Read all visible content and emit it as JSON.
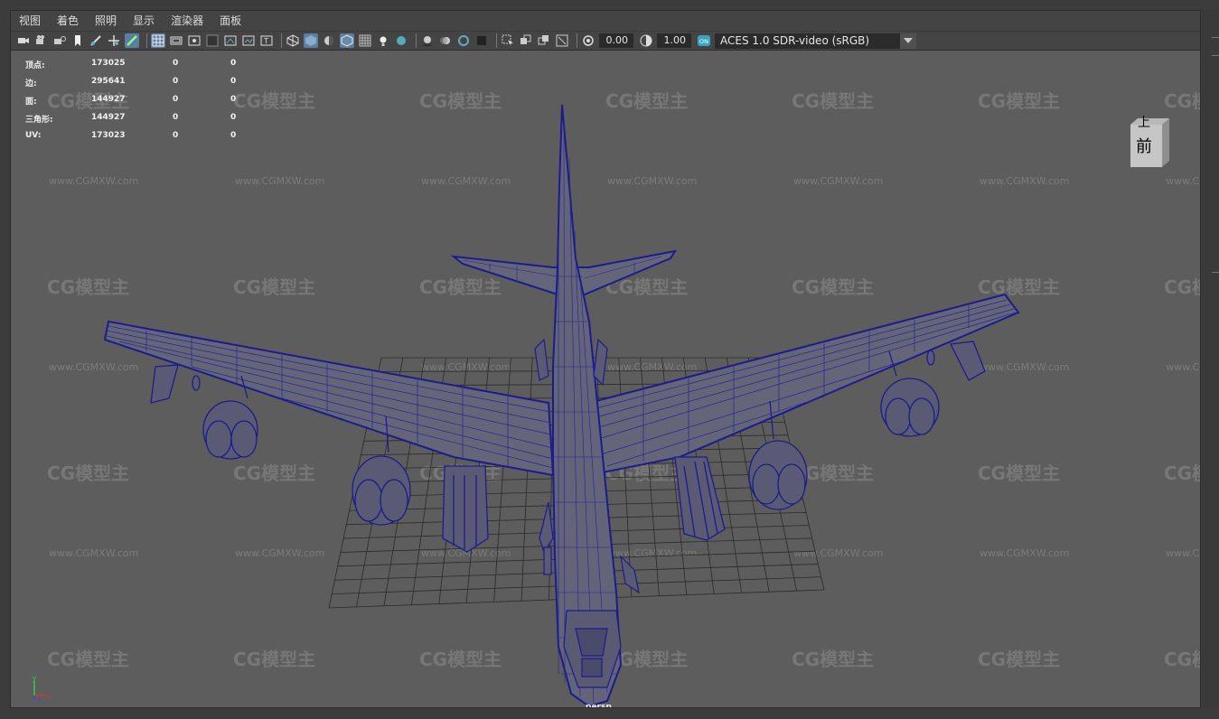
{
  "menubar": {
    "items": [
      "视图",
      "着色",
      "照明",
      "显示",
      "渲染器",
      "面板"
    ]
  },
  "toolbar": {
    "exposure": "0.00",
    "gamma": "1.00",
    "colorspace_badge": "ON",
    "colorspace": "ACES 1.0 SDR-video (sRGB)",
    "icons": [
      "camera-select-icon",
      "camera-attributes-icon",
      "bookmark-icon",
      "image-plane-icon",
      "pan-zoom-icon",
      "grease-pencil-icon",
      "grid-icon",
      "film-gate-icon",
      "resolution-gate-icon",
      "gate-mask-icon",
      "field-chart-icon",
      "safe-action-icon",
      "safe-title-icon",
      "wireframe-icon",
      "smooth-shade-icon",
      "default-material-icon",
      "wireframe-on-shaded-icon",
      "xray-icon",
      "textured-icon",
      "use-all-lights-icon",
      "shadows-icon",
      "screen-space-ao-icon",
      "motion-blur-icon",
      "multisample-aa-icon",
      "depth-of-field-icon",
      "isolate-select-icon",
      "xray-joints-icon",
      "xray-active-icon",
      "fullscreen-icon",
      "exposure-icon",
      "gamma-icon",
      "color-management-icon"
    ]
  },
  "hud": {
    "rows": [
      {
        "label": "顶点:",
        "v1": "173025",
        "v2": "0",
        "v3": "0"
      },
      {
        "label": "边:",
        "v1": "295641",
        "v2": "0",
        "v3": "0"
      },
      {
        "label": "面:",
        "v1": "144927",
        "v2": "0",
        "v3": "0"
      },
      {
        "label": "三角形:",
        "v1": "144927",
        "v2": "0",
        "v3": "0"
      },
      {
        "label": "UV:",
        "v1": "173023",
        "v2": "0",
        "v3": "0"
      }
    ]
  },
  "viewcube": {
    "top": "上",
    "front": "前"
  },
  "camera_label": "persp",
  "watermark": {
    "logo": "CG模型主",
    "url": "www.CGMXW.com"
  },
  "axis": {
    "x": "x",
    "y": "y",
    "z": "z"
  },
  "colors": {
    "wire": "#1c1c8c",
    "viewport_bg": "#5d5d5d",
    "accent": "#5b7ea1",
    "grid": "#2a2a2a"
  }
}
